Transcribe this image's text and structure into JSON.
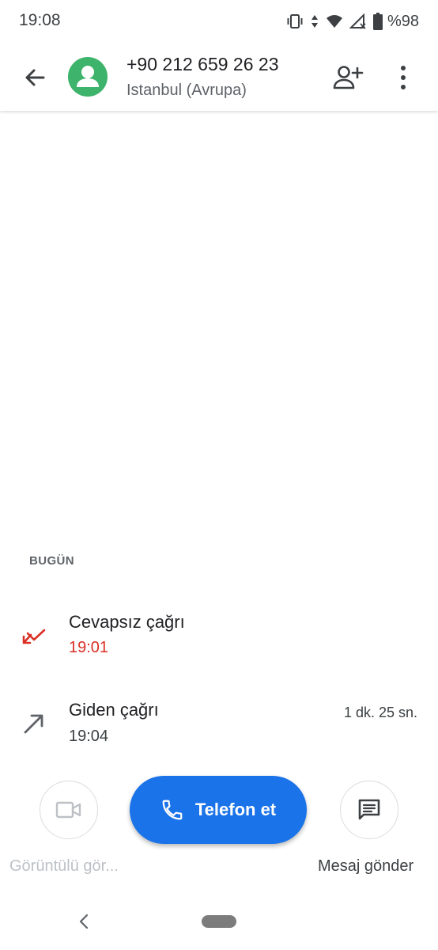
{
  "status_bar": {
    "time": "19:08",
    "battery_percent": "%98",
    "icons": [
      "vibrate-icon",
      "data-arrows-icon",
      "wifi-icon",
      "signal-icon",
      "battery-icon"
    ]
  },
  "header": {
    "back_icon": "back-arrow-icon",
    "avatar_icon": "person-icon",
    "avatar_color": "#3db36b",
    "phone_number": "+90 212 659 26 23",
    "location": "Istanbul (Avrupa)",
    "add_contact_icon": "add-person-icon",
    "more_icon": "more-vert-icon"
  },
  "history": {
    "section_label": "BUGÜN",
    "calls": [
      {
        "type": "Cevapsız çağrı",
        "time": "19:01",
        "duration": "",
        "icon": "missed-call-icon",
        "color": "#d93025"
      },
      {
        "type": "Giden çağrı",
        "time": "19:04",
        "duration": "1 dk. 25 sn.",
        "icon": "outgoing-call-icon",
        "color": "#5f6368"
      }
    ]
  },
  "actions": {
    "video": {
      "label": "Görüntülü gör...",
      "icon": "video-camera-icon",
      "enabled": false
    },
    "call": {
      "label": "Telefon et",
      "icon": "phone-icon",
      "color": "#1a73e8"
    },
    "message": {
      "label": "Mesaj gönder",
      "icon": "message-icon",
      "enabled": true
    }
  },
  "nav_bar": {
    "back_icon": "nav-back-icon",
    "home_icon": "nav-home-pill"
  }
}
